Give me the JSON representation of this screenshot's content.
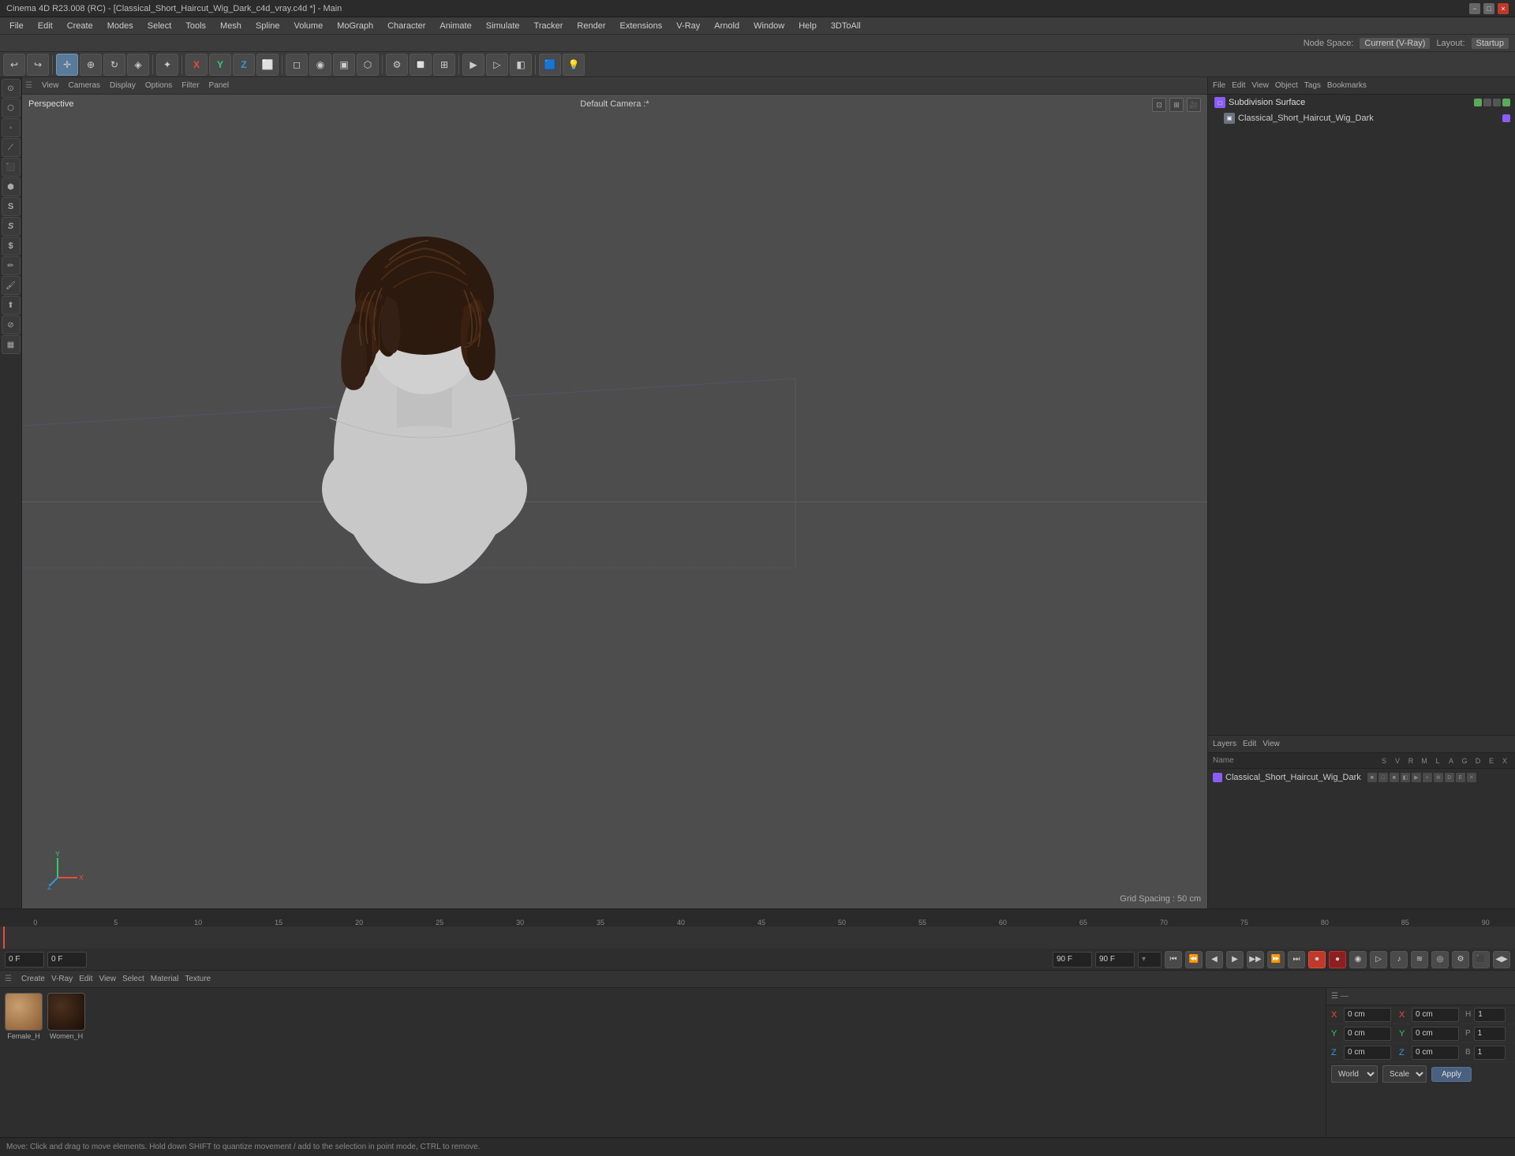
{
  "window": {
    "title": "Cinema 4D R23.008 (RC) - [Classical_Short_Haircut_Wig_Dark_c4d_vray.c4d *] - Main",
    "minimize_label": "−",
    "maximize_label": "□",
    "close_label": "×"
  },
  "menu_bar": {
    "items": [
      "File",
      "Edit",
      "Create",
      "Modes",
      "Select",
      "Tools",
      "Mesh",
      "Spline",
      "Volume",
      "MoGraph",
      "Character",
      "Animate",
      "Simulate",
      "Tracker",
      "Render",
      "Extensions",
      "V-Ray",
      "Arnold",
      "Window",
      "Help",
      "3DToAll"
    ]
  },
  "node_space_bar": {
    "label": "Node Space:",
    "value": "Current (V-Ray)",
    "layout_label": "Layout:",
    "layout_value": "Startup"
  },
  "right_panel": {
    "menu_items": [
      "File",
      "Edit",
      "View",
      "Object",
      "Tags",
      "Bookmarks"
    ],
    "objects": [
      {
        "name": "Subdivision Surface",
        "icon": "subdiv",
        "indent": 0
      },
      {
        "name": "Classical_Short_Haircut_Wig_Dark",
        "icon": "mesh",
        "indent": 1
      }
    ]
  },
  "layers_panel": {
    "menu_items": [
      "Layers",
      "Edit",
      "View"
    ],
    "columns": {
      "name": "Name",
      "icons": [
        "S",
        "V",
        "R",
        "M",
        "L",
        "A",
        "G",
        "D",
        "E",
        "X"
      ]
    },
    "items": [
      {
        "name": "Classical_Short_Haircut_Wig_Dark",
        "color": "purple"
      }
    ]
  },
  "viewport": {
    "tabs": [
      "View",
      "Cameras",
      "Display",
      "Options",
      "Filter",
      "Panel"
    ],
    "perspective_label": "Perspective",
    "camera_label": "Default Camera :*",
    "grid_spacing": "Grid Spacing : 50 cm"
  },
  "timeline": {
    "ticks": [
      0,
      5,
      10,
      15,
      20,
      25,
      30,
      35,
      40,
      45,
      50,
      55,
      60,
      65,
      70,
      75,
      80,
      85,
      90
    ],
    "current_frame": "0 F",
    "start_frame": "0 F",
    "end_frame": "90 F",
    "preview_end": "90 F"
  },
  "transport": {
    "frame_start": "0 F",
    "frame_current": "0 F",
    "buttons": [
      "⏮",
      "⏪",
      "◀",
      "▶",
      "▶▶",
      "⏩",
      "⏭",
      "⏺"
    ]
  },
  "material_area": {
    "tabs": [
      "Create",
      "V-Ray",
      "Edit",
      "View",
      "Select",
      "Material",
      "Texture"
    ],
    "materials": [
      {
        "label": "Female_H",
        "type": "skin"
      },
      {
        "label": "Women_H",
        "type": "hair"
      }
    ]
  },
  "coords": {
    "rows": [
      {
        "axis": "X",
        "pos": "0 cm",
        "axis2": "X",
        "pos2": "0 cm",
        "size_label": "H",
        "size": "1"
      },
      {
        "axis": "Y",
        "pos": "0 cm",
        "axis2": "Y",
        "pos2": "0 cm",
        "size_label": "P",
        "size": "1"
      },
      {
        "axis": "Z",
        "pos": "0 cm",
        "axis2": "Z",
        "pos2": "0 cm",
        "size_label": "B",
        "size": "1"
      }
    ],
    "mode_options": [
      "World",
      "Scale"
    ],
    "mode_world": "World",
    "mode_scale": "Scale",
    "apply_label": "Apply"
  },
  "status_bar": {
    "text": "Move: Click and drag to move elements. Hold down SHIFT to quantize movement / add to the selection in point mode, CTRL to remove."
  }
}
